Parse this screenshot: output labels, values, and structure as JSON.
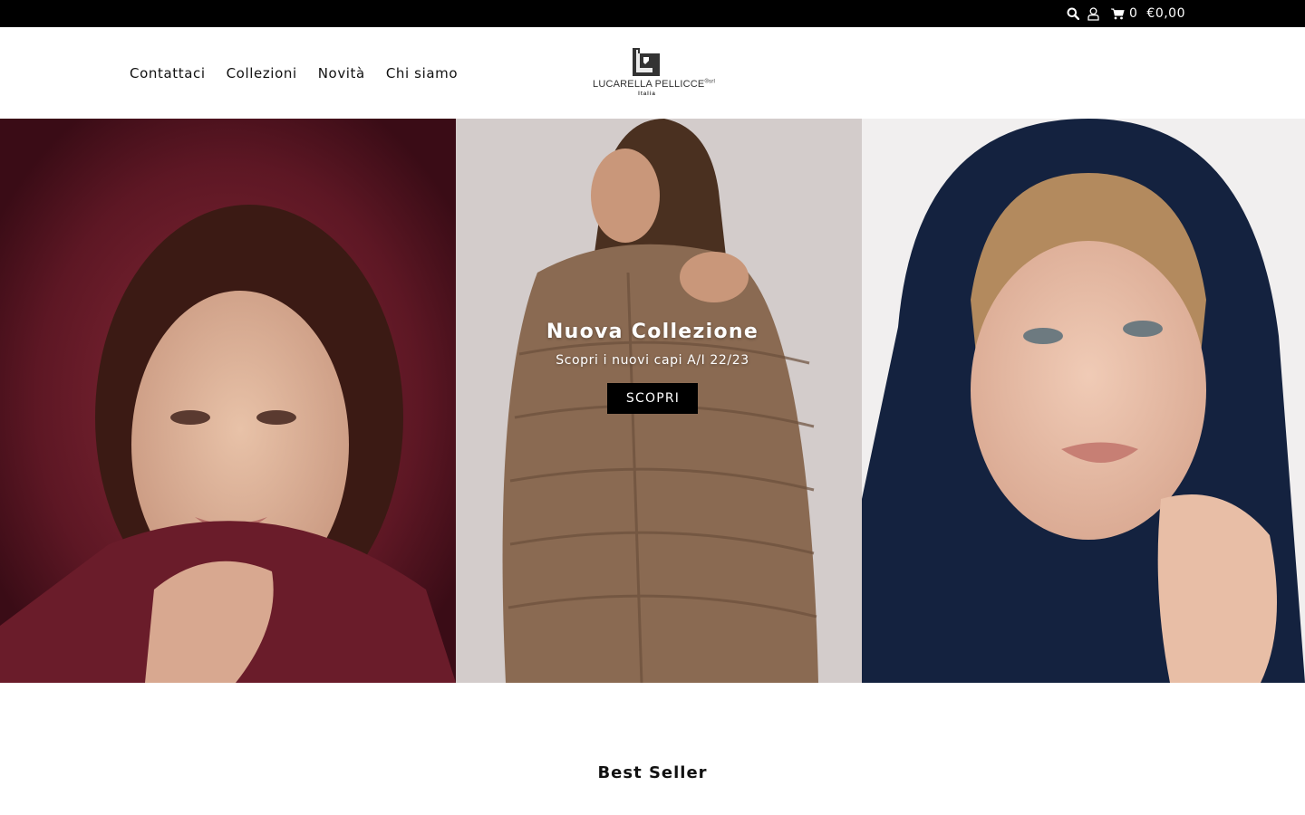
{
  "topbar": {
    "search_icon": "search-icon",
    "account_icon": "user-icon",
    "cart_icon": "cart-icon",
    "cart_count": "0",
    "cart_total": "€0,00"
  },
  "nav": {
    "items": [
      {
        "label": "Contattaci"
      },
      {
        "label": "Collezioni"
      },
      {
        "label": "Novità"
      },
      {
        "label": "Chi siamo"
      }
    ]
  },
  "logo": {
    "name": "LUCARELLA PELLICCE",
    "suffix": "®srl",
    "subtitle": "Italia"
  },
  "hero": {
    "title": "Nuova Collezione",
    "subtitle": "Scopri i nuovi capi A/I 22/23",
    "button_label": "SCOPRI",
    "panels": [
      {
        "fur_color": "#5a1522"
      },
      {
        "fur_color": "#8a6a52"
      },
      {
        "fur_color": "#14223f"
      }
    ]
  },
  "section": {
    "title": "Best Seller"
  }
}
